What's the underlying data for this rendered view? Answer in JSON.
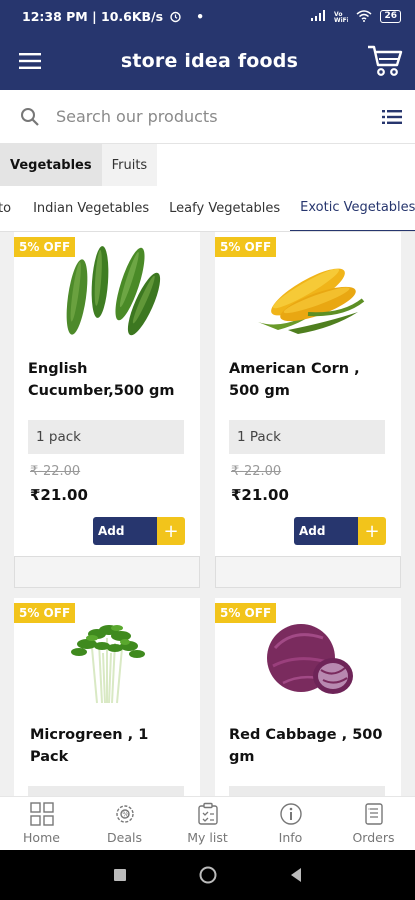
{
  "status": {
    "time_info": "12:38 PM | 10.6KB/s",
    "battery": "26"
  },
  "app": {
    "title": "store idea foods"
  },
  "search": {
    "placeholder": "Search our products"
  },
  "category_tabs": [
    {
      "label": "Vegetables",
      "active": true
    },
    {
      "label": "Fruits",
      "active": false
    }
  ],
  "sub_tabs": [
    {
      "label": "to",
      "active": false
    },
    {
      "label": "Indian Vegetables",
      "active": false
    },
    {
      "label": "Leafy Vegetables",
      "active": false
    },
    {
      "label": "Exotic Vegetables",
      "active": true
    }
  ],
  "products": [
    {
      "badge": "5% OFF",
      "name": "English Cucumber,500 gm",
      "pack": "1 pack",
      "mrp": "₹-22.00",
      "price": "₹21.00",
      "add_label": "Add",
      "plus": "+",
      "image_icon": "cucumber-image"
    },
    {
      "badge": "5% OFF",
      "name": "American Corn , 500 gm",
      "pack": "1 Pack",
      "mrp": "₹-22.00",
      "price": "₹21.00",
      "add_label": "Add",
      "plus": "+",
      "image_icon": "corn-image"
    },
    {
      "badge": "5% OFF",
      "name": "Microgreen , 1 Pack",
      "image_icon": "microgreen-image"
    },
    {
      "badge": "5% OFF",
      "name": "Red Cabbage , 500 gm",
      "image_icon": "red-cabbage-image"
    }
  ],
  "bottom_nav": [
    {
      "label": "Home",
      "icon": "home-grid-icon"
    },
    {
      "label": "Deals",
      "icon": "deals-gear-icon"
    },
    {
      "label": "My list",
      "icon": "list-icon"
    },
    {
      "label": "Info",
      "icon": "info-icon"
    },
    {
      "label": "Orders",
      "icon": "orders-icon"
    }
  ],
  "colors": {
    "primary": "#27366e",
    "accent": "#f2c41b"
  }
}
